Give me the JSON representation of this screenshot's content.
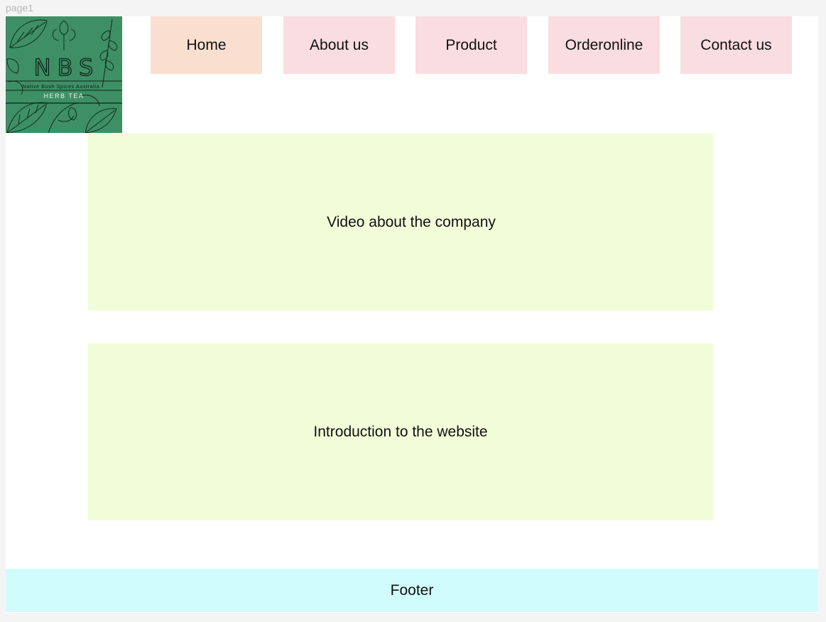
{
  "frame": {
    "label": "page1"
  },
  "logo": {
    "title": "NBS",
    "subtitle": "Native Bush Spices Australia",
    "tagline": "HERB TEA",
    "background_color": "#3e8f65"
  },
  "nav": {
    "items": [
      {
        "label": "Home",
        "active": true
      },
      {
        "label": "About us",
        "active": false
      },
      {
        "label": "Product",
        "active": false
      },
      {
        "label": "Orderonline",
        "active": false
      },
      {
        "label": "Contact us",
        "active": false
      }
    ]
  },
  "main": {
    "video_block": "Video about the company",
    "intro_block": "Introduction to the website"
  },
  "footer": {
    "label": "Footer"
  },
  "colors": {
    "nav_active": "#fadfd1",
    "nav_default": "#f9dde1",
    "content_block": "#f1fdd8",
    "footer": "#d1fcfc"
  }
}
